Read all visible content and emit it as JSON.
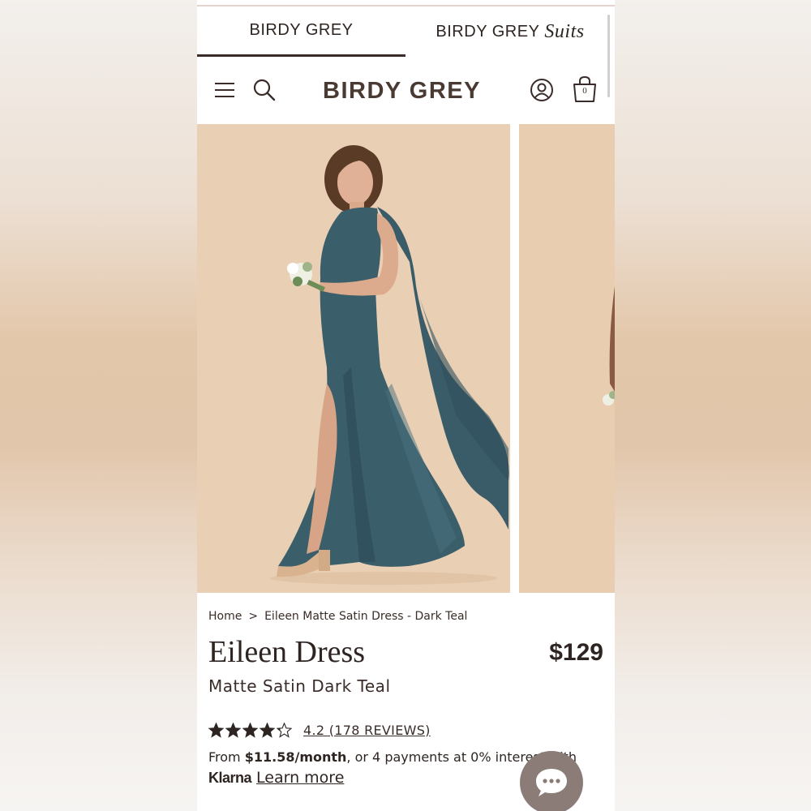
{
  "brand_tabs": {
    "tab1": "BIRDY GREY",
    "tab2_main": "BIRDY GREY",
    "tab2_suits": "Suits"
  },
  "header": {
    "logo": "BIRDY GREY",
    "bag_count": "0",
    "icons": [
      "menu-icon",
      "search-icon",
      "account-icon",
      "bag-icon"
    ]
  },
  "breadcrumb": {
    "home": "Home",
    "separator": ">",
    "current": "Eileen Matte Satin Dress - Dark Teal"
  },
  "product": {
    "title": "Eileen Dress",
    "price": "$129",
    "subtitle": "Matte Satin Dark Teal",
    "rating_value": 4.2,
    "rating_text": "4.2 (178 REVIEWS)"
  },
  "finance": {
    "prefix": "From ",
    "amount": "$11.58/month",
    "suffix": ", or 4 payments at 0% interest with",
    "klarna": "Klarna",
    "learn_more": "Learn more"
  },
  "colors": {
    "text_dark": "#2e2522",
    "backdrop": "#e9cfb4",
    "dress": "#3b5e6b",
    "chat_button": "#8b7c77"
  }
}
